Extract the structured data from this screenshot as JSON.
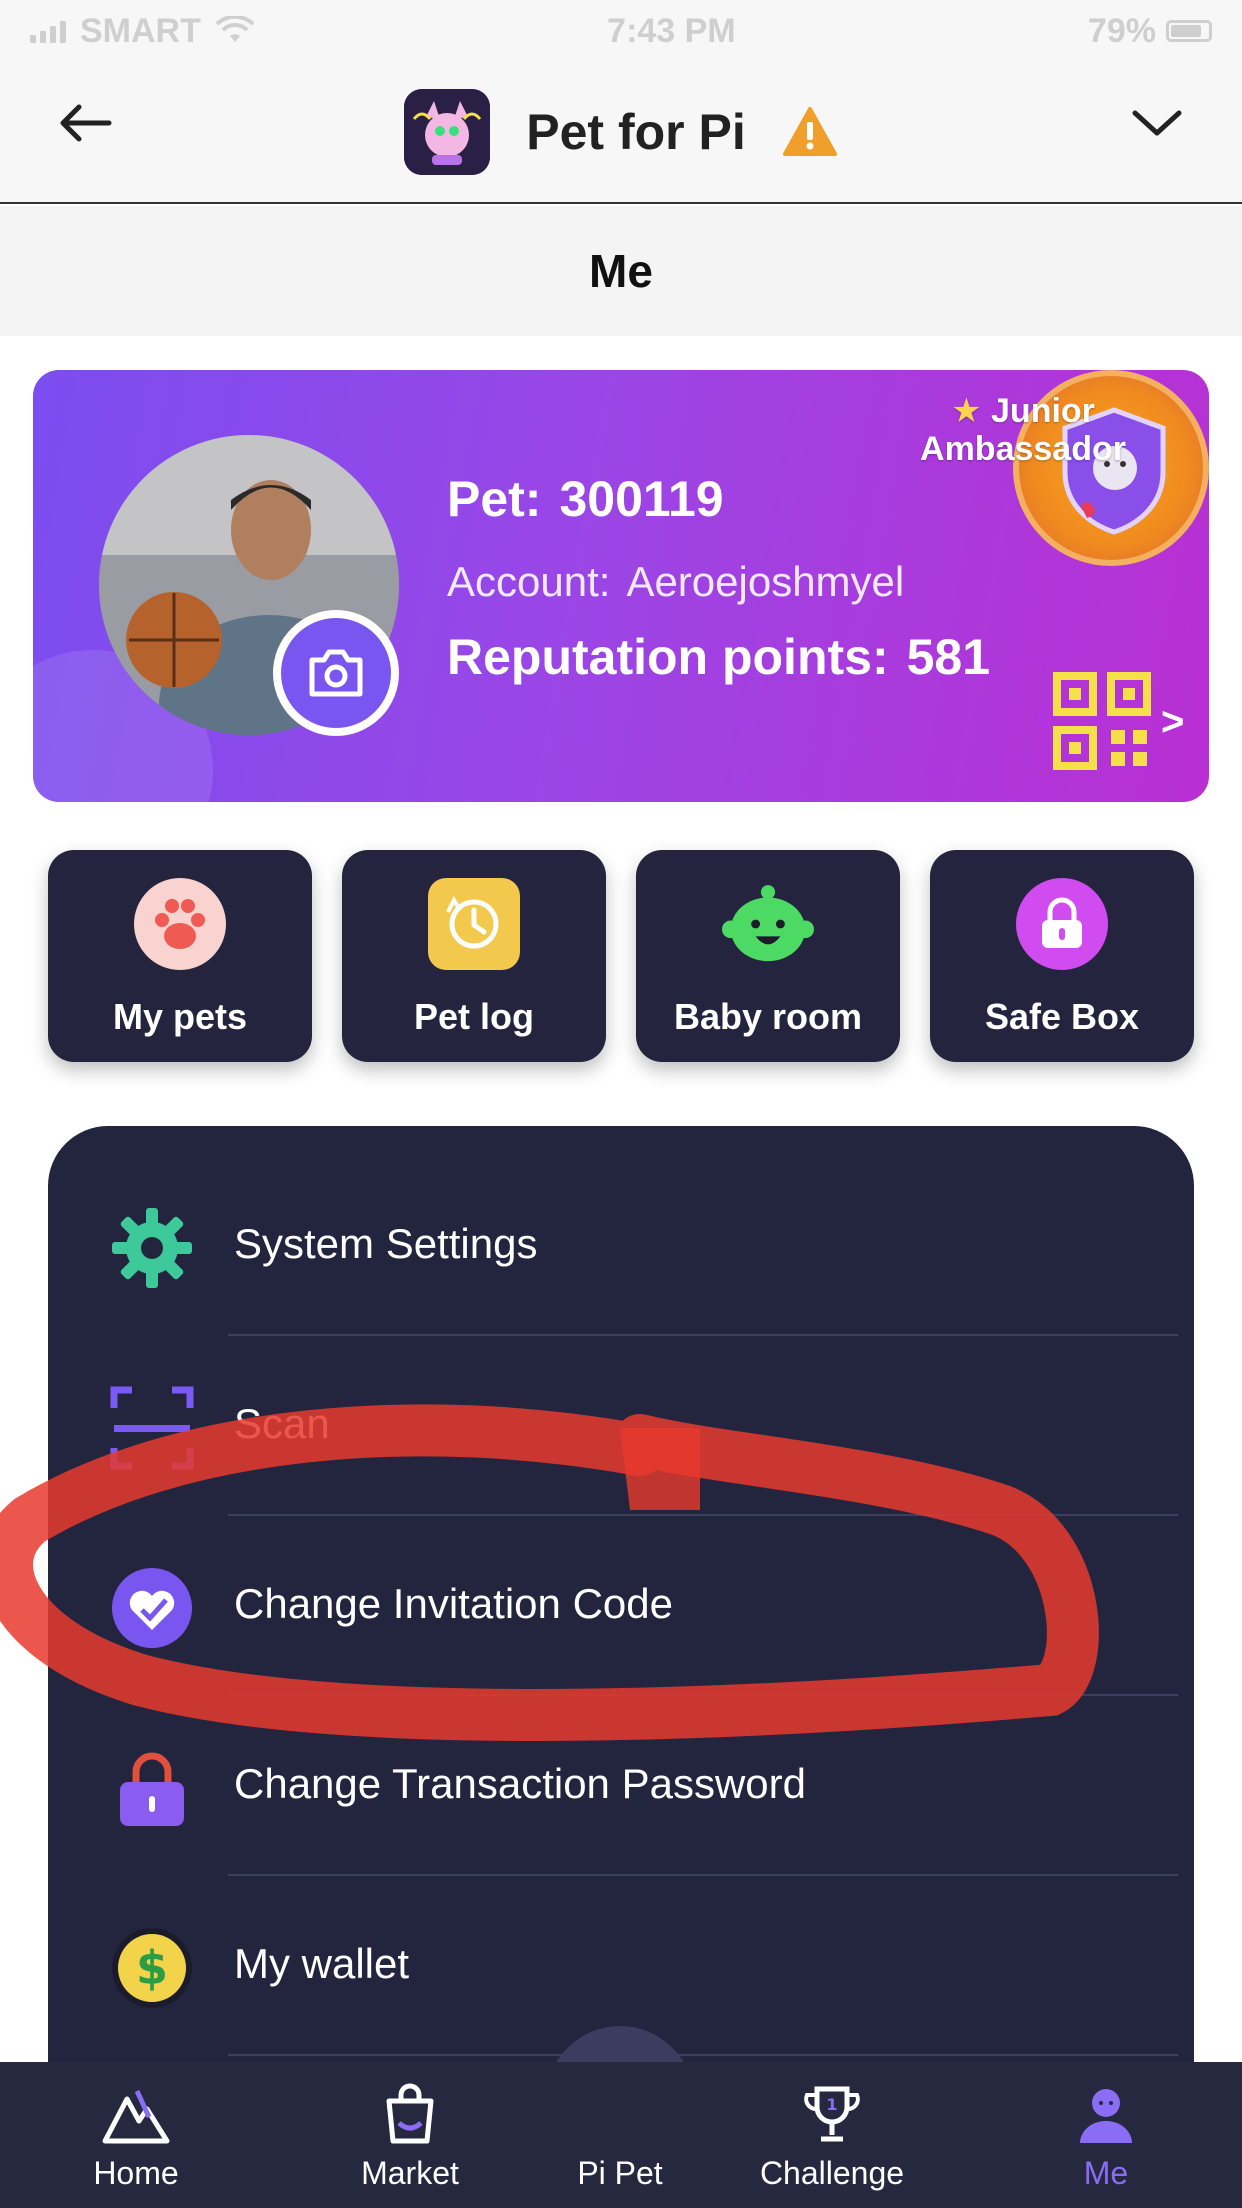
{
  "status_bar": {
    "carrier": "SMART",
    "time": "7:43 PM",
    "battery": "79%"
  },
  "header": {
    "app_title": "Pet for Pi",
    "page_title": "Me"
  },
  "profile": {
    "pet_label": "Pet:",
    "pet_id": "300119",
    "account_label": "Account:",
    "account_name": "Aeroejoshmyel",
    "reputation_label": "Reputation points:",
    "reputation_value": "581",
    "badge_title": "Junior Ambassador",
    "qr_arrow": ">"
  },
  "quick_actions": [
    {
      "label": "My pets",
      "icon": "paw-icon",
      "color": "#f8c6c1"
    },
    {
      "label": "Pet log",
      "icon": "history-icon",
      "color": "#f2c94c"
    },
    {
      "label": "Baby room",
      "icon": "baby-face-icon",
      "color": "#4cd964"
    },
    {
      "label": "Safe Box",
      "icon": "safe-lock-icon",
      "color": "#d04cf0"
    }
  ],
  "menu": [
    {
      "label": "System Settings",
      "icon": "gear-icon"
    },
    {
      "label": "Scan",
      "icon": "scan-icon"
    },
    {
      "label": "Change Invitation Code",
      "icon": "invitation-heart-icon"
    },
    {
      "label": "Change Transaction Password",
      "icon": "lock-icon"
    },
    {
      "label": "My wallet",
      "icon": "dollar-coin-icon"
    }
  ],
  "bottom_nav": [
    {
      "label": "Home",
      "icon": "mountain-icon",
      "active": false
    },
    {
      "label": "Market",
      "icon": "shopping-bag-icon",
      "active": false
    },
    {
      "label": "Pi Pet",
      "icon": "paw-icon",
      "active": false
    },
    {
      "label": "Challenge",
      "icon": "trophy-icon",
      "active": false
    },
    {
      "label": "Me",
      "icon": "person-icon",
      "active": true
    }
  ],
  "colors": {
    "card_gradient_start": "#7b4df0",
    "card_gradient_end": "#b92fd3",
    "panel_bg": "#23253f",
    "nav_active": "#8a6cf5",
    "annotation_red": "#e83a2e"
  }
}
